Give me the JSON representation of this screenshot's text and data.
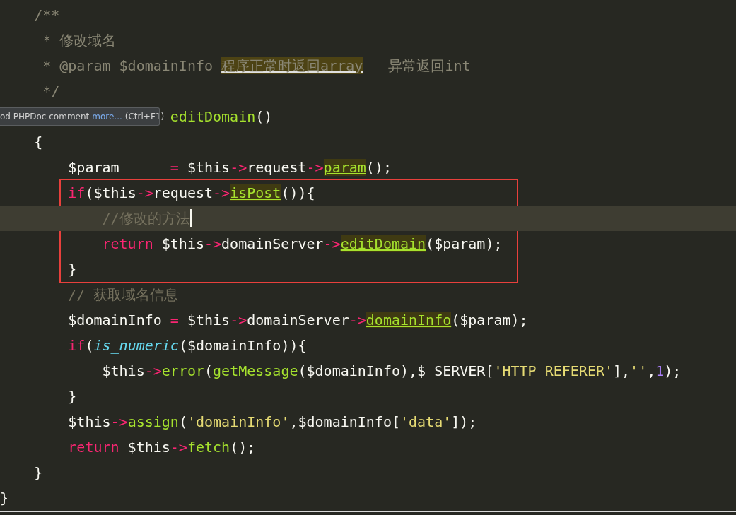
{
  "editor": {
    "lines": [
      {
        "kind": "line",
        "current": false,
        "tokens": [
          {
            "kind": "doc",
            "text": "    /**"
          }
        ]
      },
      {
        "kind": "line",
        "current": false,
        "tokens": [
          {
            "kind": "doc",
            "text": "     * 修改域名"
          }
        ]
      },
      {
        "kind": "line",
        "current": false,
        "tokens": [
          {
            "kind": "doc",
            "text": "     * @param $domainInfo "
          },
          {
            "kind": "doc-mark",
            "text": "程序正常时返回array"
          },
          {
            "kind": "doc",
            "text": "   异常返回int"
          }
        ]
      },
      {
        "kind": "line",
        "current": false,
        "tokens": [
          {
            "kind": "doc",
            "text": "     */"
          }
        ]
      },
      {
        "kind": "line",
        "current": false,
        "tokens": [
          {
            "kind": "func",
            "text": "                    editDomain"
          },
          {
            "kind": "plain",
            "text": "()"
          }
        ]
      },
      {
        "kind": "line",
        "current": false,
        "tokens": [
          {
            "kind": "plain",
            "text": "    {"
          }
        ]
      },
      {
        "kind": "line",
        "current": false,
        "tokens": [
          {
            "kind": "plain",
            "text": "        $param      "
          },
          {
            "kind": "keyword",
            "text": "="
          },
          {
            "kind": "plain",
            "text": " $this"
          },
          {
            "kind": "keyword",
            "text": "->"
          },
          {
            "kind": "plain",
            "text": "request"
          },
          {
            "kind": "keyword",
            "text": "->"
          },
          {
            "kind": "call",
            "text": "param"
          },
          {
            "kind": "plain",
            "text": "();"
          }
        ]
      },
      {
        "kind": "frame",
        "lines": [
          {
            "kind": "line",
            "current": false,
            "tokens": [
              {
                "kind": "keyword",
                "text": "        if"
              },
              {
                "kind": "plain",
                "text": "($this"
              },
              {
                "kind": "keyword",
                "text": "->"
              },
              {
                "kind": "plain",
                "text": "request"
              },
              {
                "kind": "keyword",
                "text": "->"
              },
              {
                "kind": "call",
                "text": "isPost"
              },
              {
                "kind": "plain",
                "text": "()){"
              }
            ]
          },
          {
            "kind": "line",
            "current": true,
            "tokens": [
              {
                "kind": "comment",
                "text": "            //修改的方法"
              }
            ]
          },
          {
            "kind": "line",
            "current": false,
            "tokens": [
              {
                "kind": "keyword",
                "text": "            return"
              },
              {
                "kind": "plain",
                "text": " $this"
              },
              {
                "kind": "keyword",
                "text": "->"
              },
              {
                "kind": "plain",
                "text": "domainServer"
              },
              {
                "kind": "keyword",
                "text": "->"
              },
              {
                "kind": "call",
                "text": "editDomain"
              },
              {
                "kind": "plain",
                "text": "($param);"
              }
            ]
          },
          {
            "kind": "line",
            "current": false,
            "tokens": [
              {
                "kind": "plain",
                "text": "        }"
              }
            ]
          }
        ]
      },
      {
        "kind": "line",
        "current": false,
        "tokens": [
          {
            "kind": "comment",
            "text": "        // 获取域名信息"
          }
        ]
      },
      {
        "kind": "line",
        "current": false,
        "tokens": [
          {
            "kind": "plain",
            "text": "        $domainInfo "
          },
          {
            "kind": "keyword",
            "text": "="
          },
          {
            "kind": "plain",
            "text": " $this"
          },
          {
            "kind": "keyword",
            "text": "->"
          },
          {
            "kind": "plain",
            "text": "domainServer"
          },
          {
            "kind": "keyword",
            "text": "->"
          },
          {
            "kind": "call",
            "text": "domainInfo"
          },
          {
            "kind": "plain",
            "text": "($param);"
          }
        ]
      },
      {
        "kind": "line",
        "current": false,
        "tokens": [
          {
            "kind": "keyword",
            "text": "        if"
          },
          {
            "kind": "plain",
            "text": "("
          },
          {
            "kind": "builtin",
            "text": "is_numeric"
          },
          {
            "kind": "plain",
            "text": "($domainInfo)){"
          }
        ]
      },
      {
        "kind": "line",
        "current": false,
        "tokens": [
          {
            "kind": "plain",
            "text": "            $this"
          },
          {
            "kind": "keyword",
            "text": "->"
          },
          {
            "kind": "func",
            "text": "error"
          },
          {
            "kind": "plain",
            "text": "("
          },
          {
            "kind": "func",
            "text": "getMessage"
          },
          {
            "kind": "plain",
            "text": "($domainInfo),$_SERVER["
          },
          {
            "kind": "string",
            "text": "'HTTP_REFERER'"
          },
          {
            "kind": "plain",
            "text": "],"
          },
          {
            "kind": "string",
            "text": "''"
          },
          {
            "kind": "plain",
            "text": ","
          },
          {
            "kind": "number",
            "text": "1"
          },
          {
            "kind": "plain",
            "text": ");"
          }
        ]
      },
      {
        "kind": "line",
        "current": false,
        "tokens": [
          {
            "kind": "plain",
            "text": "        }"
          }
        ]
      },
      {
        "kind": "line",
        "current": false,
        "tokens": [
          {
            "kind": "plain",
            "text": "        $this"
          },
          {
            "kind": "keyword",
            "text": "->"
          },
          {
            "kind": "func",
            "text": "assign"
          },
          {
            "kind": "plain",
            "text": "("
          },
          {
            "kind": "string",
            "text": "'domainInfo'"
          },
          {
            "kind": "plain",
            "text": ",$domainInfo["
          },
          {
            "kind": "string",
            "text": "'data'"
          },
          {
            "kind": "plain",
            "text": "]);"
          }
        ]
      },
      {
        "kind": "line",
        "current": false,
        "tokens": [
          {
            "kind": "keyword",
            "text": "        return"
          },
          {
            "kind": "plain",
            "text": " $this"
          },
          {
            "kind": "keyword",
            "text": "->"
          },
          {
            "kind": "func",
            "text": "fetch"
          },
          {
            "kind": "plain",
            "text": "();"
          }
        ]
      },
      {
        "kind": "line",
        "current": false,
        "tokens": [
          {
            "kind": "plain",
            "text": "    }"
          }
        ]
      },
      {
        "kind": "line",
        "current": false,
        "tokens": [
          {
            "kind": "plain",
            "text": "}"
          }
        ]
      }
    ]
  },
  "tooltip": {
    "text": "od PHPDoc comment",
    "link": "more...",
    "shortcut": "(Ctrl+F1)"
  }
}
